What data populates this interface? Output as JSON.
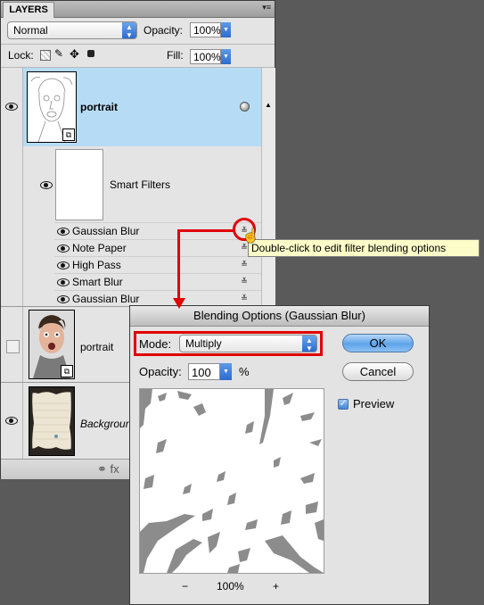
{
  "panel": {
    "tab_label": "LAYERS",
    "menu_glyph": "▾≡",
    "blend_mode": "Normal",
    "opacity_label": "Opacity:",
    "opacity_value": "100%",
    "lock_label": "Lock:",
    "fill_label": "Fill:",
    "fill_value": "100%",
    "layers": [
      {
        "name": "portrait",
        "selected": true,
        "visible": true
      },
      {
        "name": "Smart Filters",
        "visible": true
      },
      {
        "name": "portrait",
        "visible": false
      },
      {
        "name": "Background",
        "visible": true
      }
    ],
    "filters": [
      "Gaussian Blur",
      "Note Paper",
      "High Pass",
      "Smart Blur",
      "Gaussian Blur"
    ],
    "footer_glyphs": "⚭  fx"
  },
  "tooltip": "Double-click to edit filter blending options",
  "dialog": {
    "title": "Blending Options (Gaussian Blur)",
    "mode_label": "Mode:",
    "mode_value": "Multiply",
    "opacity_label": "Opacity:",
    "opacity_value": "100",
    "opacity_unit": "%",
    "ok_label": "OK",
    "cancel_label": "Cancel",
    "preview_label": "Preview",
    "preview_checked": true,
    "zoom_minus": "−",
    "zoom_value": "100%",
    "zoom_plus": "+"
  },
  "colors": {
    "selection": "#b6dcf5",
    "annotation": "#e00000",
    "tooltip_bg": "#fdfdc9"
  }
}
